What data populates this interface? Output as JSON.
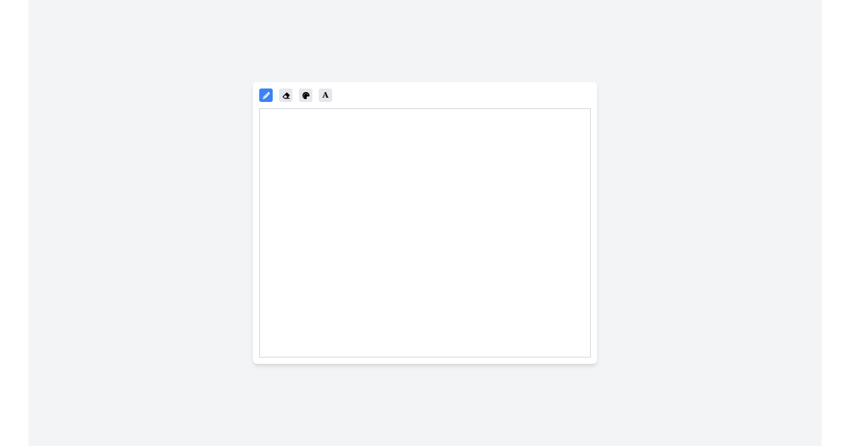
{
  "toolbar": [
    {
      "kind": "pencil",
      "selected": true
    },
    {
      "kind": "eraser",
      "selected": false
    },
    {
      "kind": "palette",
      "selected": false
    },
    {
      "kind": "text",
      "label": "A",
      "selected": false
    }
  ]
}
